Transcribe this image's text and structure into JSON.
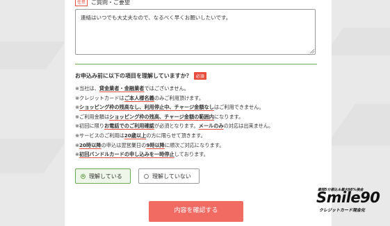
{
  "form": {
    "question_label": "ご質問・ご要望",
    "optional_tag": "任意",
    "question_value": "連絡はいつでも大丈夫なので、なるべく早くお願いしたいです。",
    "notice_title": "お申込み前に以下の項目を理解していますか？",
    "required_tag": "必須",
    "notes": [
      [
        "※当社は、",
        "貸金業者・金融業者",
        "ではございません。"
      ],
      [
        "※クレジットカードは",
        "ご本人様名義",
        "のみご利用頂けます。"
      ],
      [
        "※",
        "ショッピング枠の残高なし、利用停止中、チャージ金額なし",
        "はご利用できません。"
      ],
      [
        "※ご利用金額は",
        "ショッピング枠の残高、チャージ金額の範囲内",
        "になります。"
      ],
      [
        "※初回に限り",
        "お電話でのご利用確認",
        "が必須となります。",
        "メールのみ",
        "の対応は出来ません。"
      ],
      [
        "※サービスのご利用は",
        "20歳以上",
        "の方に限らせて頂きます。"
      ],
      [
        "※",
        "20時以降",
        "の申込は翌営業日の",
        "9時以降",
        "に順次ご対応になります。"
      ],
      [
        "※",
        "初回バンドルカードの申し込みを一時停止",
        "しております。"
      ]
    ],
    "radio_yes": "理解している",
    "radio_no": "理解していない",
    "selected": "理解している",
    "submit_label": "内容を確認する"
  },
  "logo": {
    "top_text": "最短5分振込＆最大98%換金",
    "main_text": "Smile90",
    "sub_text": "クレジットカード現金化"
  },
  "colors": {
    "accent_green": "#6ea84f",
    "accent_red": "#e74c3c",
    "button_bg": "#f26b63"
  }
}
